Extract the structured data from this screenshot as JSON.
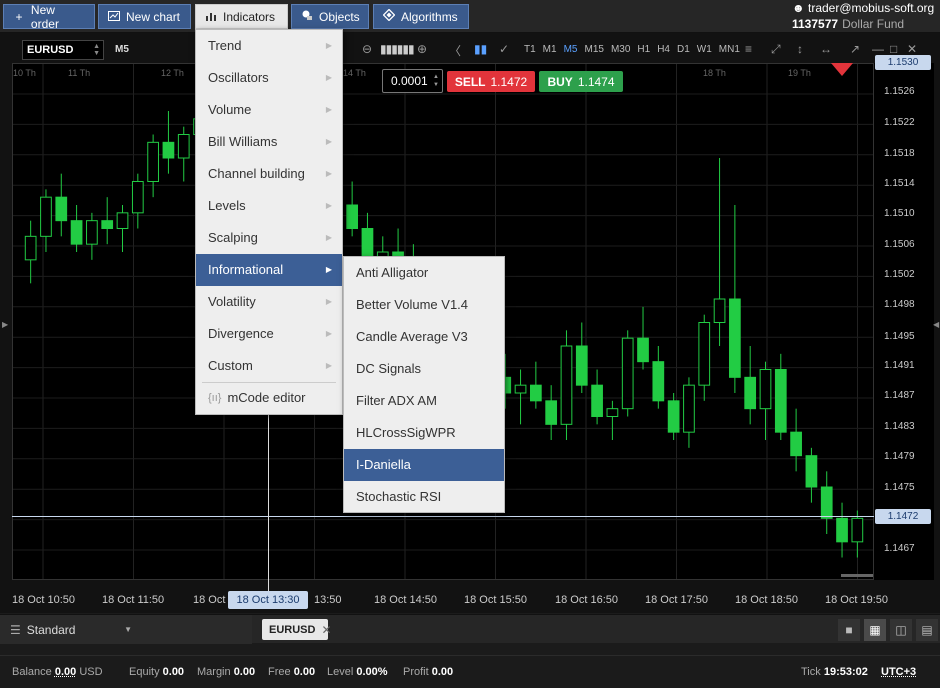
{
  "toolbar": {
    "new_order": "New order",
    "new_chart": "New chart",
    "indicators": "Indicators",
    "objects": "Objects",
    "algorithms": "Algorithms"
  },
  "account": {
    "user": "trader@mobius-soft.org",
    "number": "1137577",
    "fund": "Dollar Fund"
  },
  "chart": {
    "symbol": "EURUSD",
    "timeframe": "M5",
    "timeframes": [
      "T1",
      "M1",
      "M5",
      "M15",
      "M30",
      "H1",
      "H4",
      "D1",
      "W1",
      "MN1"
    ],
    "selected_timeframe": "M5",
    "lot": "0.0001",
    "sell_label": "SELL",
    "sell_price": "1.1472",
    "buy_label": "BUY",
    "buy_price": "1.1474",
    "price_current": "1.1472",
    "price_top": "1.1530",
    "crosshair_time": "18 Oct 13:30",
    "y_ticks": [
      "1.1526",
      "1.1522",
      "1.1518",
      "1.1514",
      "1.1510",
      "1.1506",
      "1.1502",
      "1.1498",
      "1.1495",
      "1.1491",
      "1.1487",
      "1.1483",
      "1.1479",
      "1.1475",
      "1.1467"
    ],
    "x_ticks": [
      "18 Oct 10:50",
      "18 Oct 11:50",
      "18 Oct",
      "13:50",
      "18 Oct 14:50",
      "18 Oct 15:50",
      "18 Oct 16:50",
      "18 Oct 17:50",
      "18 Oct 18:50",
      "18 Oct 19:50"
    ],
    "day_marks": [
      "10 Th",
      "11 Th",
      "12 Th",
      "14 Th",
      "18 Th",
      "19 Th"
    ]
  },
  "chart_data": {
    "type": "candlestick",
    "symbol": "EURUSD",
    "timeframe": "M5",
    "ylim": [
      1.1464,
      1.153
    ],
    "x_range": [
      "18 Oct 10:50",
      "18 Oct 19:50"
    ],
    "current_price": 1.1472,
    "candles": [
      [
        1.1505,
        1.151,
        1.1502,
        1.1508
      ],
      [
        1.1508,
        1.1514,
        1.1506,
        1.1513
      ],
      [
        1.1513,
        1.1516,
        1.1508,
        1.151
      ],
      [
        1.151,
        1.1512,
        1.1506,
        1.1507
      ],
      [
        1.1507,
        1.1511,
        1.1505,
        1.151
      ],
      [
        1.151,
        1.1513,
        1.1507,
        1.1509
      ],
      [
        1.1509,
        1.1512,
        1.1506,
        1.1511
      ],
      [
        1.1511,
        1.1516,
        1.1509,
        1.1515
      ],
      [
        1.1515,
        1.1521,
        1.1513,
        1.152
      ],
      [
        1.152,
        1.1524,
        1.1516,
        1.1518
      ],
      [
        1.1518,
        1.1522,
        1.1515,
        1.1521
      ],
      [
        1.1521,
        1.1527,
        1.1519,
        1.1523
      ],
      [
        1.1523,
        1.1526,
        1.152,
        1.1522
      ],
      [
        1.1522,
        1.1525,
        1.1518,
        1.152
      ],
      [
        1.152,
        1.1523,
        1.1517,
        1.1519
      ],
      [
        1.1519,
        1.1521,
        1.1516,
        1.152
      ],
      [
        1.152,
        1.1522,
        1.1518,
        1.1521
      ],
      [
        1.1521,
        1.1524,
        1.1519,
        1.152
      ],
      [
        1.152,
        1.1522,
        1.1517,
        1.1518
      ],
      [
        1.1518,
        1.152,
        1.1514,
        1.1515
      ],
      [
        1.1515,
        1.1518,
        1.1511,
        1.1512
      ],
      [
        1.1512,
        1.1515,
        1.1508,
        1.1509
      ],
      [
        1.1509,
        1.1511,
        1.1503,
        1.1505
      ],
      [
        1.1505,
        1.1508,
        1.1502,
        1.1506
      ],
      [
        1.1506,
        1.1509,
        1.1503,
        1.1504
      ],
      [
        1.1504,
        1.1507,
        1.15,
        1.1501
      ],
      [
        1.1501,
        1.1504,
        1.1496,
        1.1497
      ],
      [
        1.1497,
        1.1499,
        1.1492,
        1.1494
      ],
      [
        1.1494,
        1.1497,
        1.1491,
        1.1495
      ],
      [
        1.1495,
        1.1498,
        1.1493,
        1.1496
      ],
      [
        1.1496,
        1.1497,
        1.1489,
        1.149
      ],
      [
        1.149,
        1.1493,
        1.1486,
        1.1488
      ],
      [
        1.1488,
        1.1491,
        1.1484,
        1.1489
      ],
      [
        1.1489,
        1.1492,
        1.1486,
        1.1487
      ],
      [
        1.1487,
        1.1489,
        1.1482,
        1.1484
      ],
      [
        1.1484,
        1.1496,
        1.1482,
        1.1494
      ],
      [
        1.1494,
        1.1497,
        1.1488,
        1.1489
      ],
      [
        1.1489,
        1.1491,
        1.1484,
        1.1485
      ],
      [
        1.1485,
        1.1487,
        1.1482,
        1.1486
      ],
      [
        1.1486,
        1.1496,
        1.1485,
        1.1495
      ],
      [
        1.1495,
        1.1499,
        1.1491,
        1.1492
      ],
      [
        1.1492,
        1.1494,
        1.1486,
        1.1487
      ],
      [
        1.1487,
        1.1488,
        1.1482,
        1.1483
      ],
      [
        1.1483,
        1.149,
        1.1481,
        1.1489
      ],
      [
        1.1489,
        1.1498,
        1.1487,
        1.1497
      ],
      [
        1.1497,
        1.1518,
        1.1494,
        1.15
      ],
      [
        1.15,
        1.1512,
        1.1488,
        1.149
      ],
      [
        1.149,
        1.1494,
        1.1484,
        1.1486
      ],
      [
        1.1486,
        1.1492,
        1.1482,
        1.1491
      ],
      [
        1.1491,
        1.1493,
        1.1482,
        1.1483
      ],
      [
        1.1483,
        1.1486,
        1.1478,
        1.148
      ],
      [
        1.148,
        1.1481,
        1.1474,
        1.1476
      ],
      [
        1.1476,
        1.1478,
        1.147,
        1.1472
      ],
      [
        1.1472,
        1.1474,
        1.1467,
        1.1469
      ],
      [
        1.1469,
        1.1473,
        1.1467,
        1.1472
      ]
    ]
  },
  "indicators_menu": {
    "items": [
      "Trend",
      "Oscillators",
      "Volume",
      "Bill Williams",
      "Channel building",
      "Levels",
      "Scalping",
      "Informational",
      "Volatility",
      "Divergence",
      "Custom"
    ],
    "highlighted": "Informational",
    "editor": "mCode editor"
  },
  "informational_menu": {
    "items": [
      "Anti Alligator",
      "Better Volume V1.4",
      "Candle Average V3",
      "DC Signals",
      "Filter ADX AM",
      "HLCrossSigWPR",
      "I-Daniella",
      "Stochastic RSI"
    ],
    "highlighted": "I-Daniella"
  },
  "bottom": {
    "layout": "Standard",
    "tab": "EURUSD"
  },
  "status": {
    "balance_label": "Balance",
    "balance": "0.00",
    "currency": "USD",
    "equity_label": "Equity",
    "equity": "0.00",
    "margin_label": "Margin",
    "margin": "0.00",
    "free_label": "Free",
    "free": "0.00",
    "level_label": "Level",
    "level": "0.00%",
    "profit_label": "Profit",
    "profit": "0.00",
    "tick_label": "Tick",
    "time": "19:53:02",
    "tz": "UTC+3"
  },
  "colors": {
    "accent": "#3c5f96",
    "sell": "#e2343b",
    "buy": "#2da04c",
    "candle": "#22cc44"
  }
}
